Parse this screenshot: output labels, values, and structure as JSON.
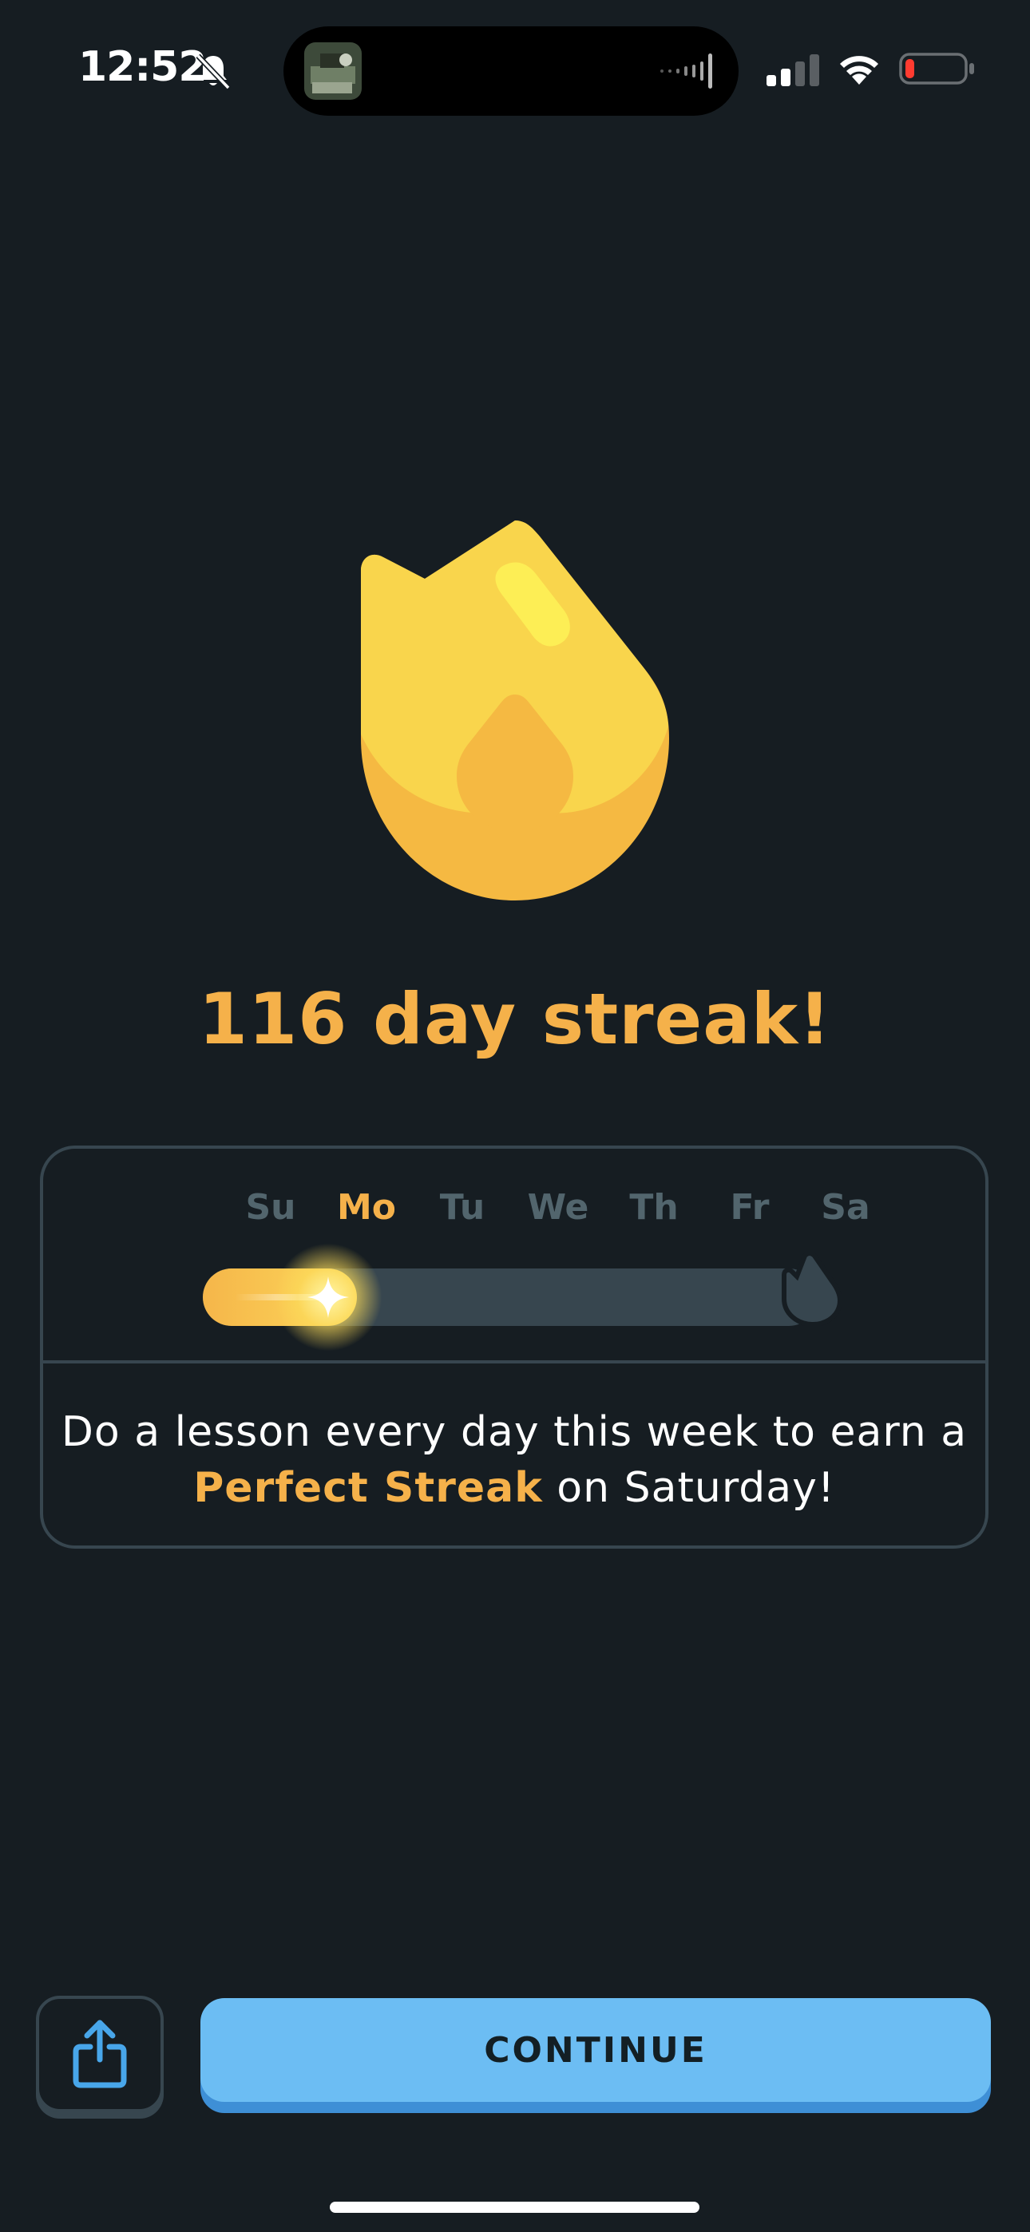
{
  "status_bar": {
    "time": "12:52",
    "icons": [
      "bell-slash-icon",
      "signal-icon",
      "wifi-icon",
      "battery-low-icon"
    ],
    "battery_level": 0.15
  },
  "streak": {
    "title": "116 day streak!"
  },
  "week": {
    "days": [
      "Su",
      "Mo",
      "Tu",
      "We",
      "Th",
      "Fr",
      "Sa"
    ],
    "active_day_index": 1,
    "progress_fraction": 0.25
  },
  "card": {
    "message_prefix": "Do a lesson every day this week to earn a",
    "highlight": "Perfect Streak",
    "message_suffix": " on Saturday!"
  },
  "buttons": {
    "continue_label": "CONTINUE",
    "share_icon": "share-icon"
  },
  "colors": {
    "background": "#161d22",
    "accent_orange": "#f5b14a",
    "flame_yellow": "#f9d54c",
    "continue_blue": "#6cbdf3",
    "border": "#37464f"
  }
}
